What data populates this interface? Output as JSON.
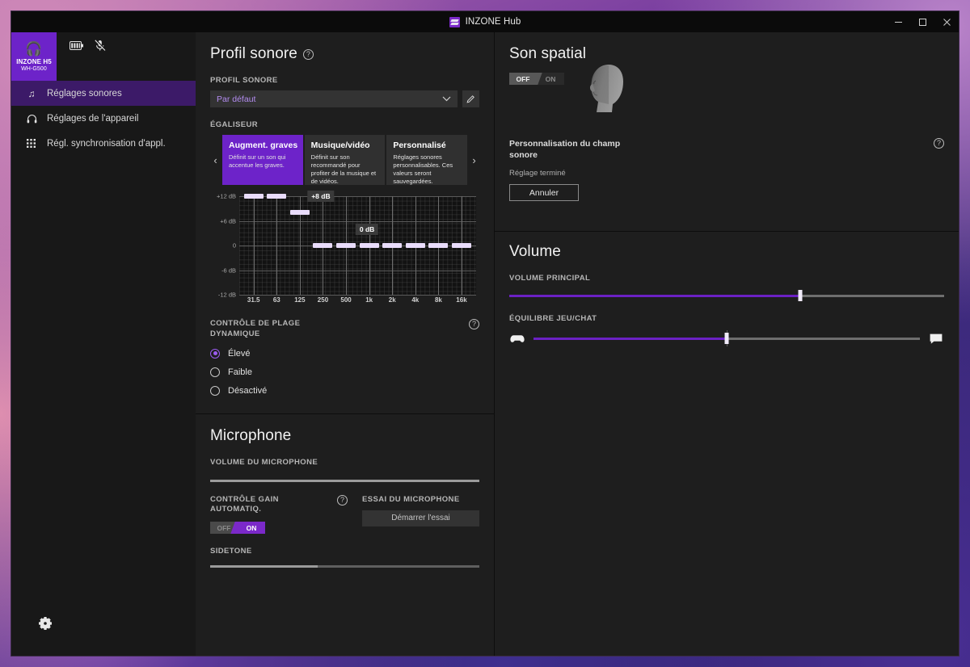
{
  "window": {
    "title": "INZONE Hub",
    "logo_icon": "inzone-logo",
    "controls": {
      "minimize": "–",
      "maximize": "□",
      "close": "✕"
    }
  },
  "sidebar": {
    "device": {
      "icon": "headset-icon",
      "name": "INZONE H5",
      "model": "WH-G500"
    },
    "status_icons": [
      {
        "name": "battery-icon"
      },
      {
        "name": "microphone-muted-icon"
      }
    ],
    "items": [
      {
        "icon": "music-note-icon",
        "label": "Réglages sonores",
        "active": true
      },
      {
        "icon": "headphones-icon",
        "label": "Réglages de l'appareil",
        "active": false
      },
      {
        "icon": "app-grid-icon",
        "label": "Régl. synchronisation d'appl.",
        "active": false
      }
    ],
    "settings_icon": "gear-icon"
  },
  "sound_profile": {
    "heading": "Profil sonore",
    "help_icon": "?",
    "profile_label": "PROFIL SONORE",
    "profile_value": "Par défaut",
    "chevron": "⌄",
    "edit_icon": "pencil-icon",
    "equalizer_label": "ÉGALISEUR",
    "prev_arrow": "‹",
    "next_arrow": "›",
    "presets": [
      {
        "title": "Augment. graves",
        "desc": "Définit sur un son qui accentue les graves.",
        "selected": true
      },
      {
        "title": "Musique/vidéo",
        "desc": "Définit sur son recommandé pour profiter de la musique et de vidéos.",
        "selected": false
      },
      {
        "title": "Personnalisé",
        "desc": "Réglages sonores personnalisables. Ces valeurs seront sauvegardées.",
        "selected": false
      }
    ],
    "dynamic_range": {
      "label": "CONTRÔLE DE PLAGE DYNAMIQUE",
      "help_icon": "?",
      "options": [
        {
          "label": "Élevé",
          "selected": true
        },
        {
          "label": "Faible",
          "selected": false
        },
        {
          "label": "Désactivé",
          "selected": false
        }
      ]
    }
  },
  "chart_data": {
    "type": "bar",
    "title": "ÉGALISEUR",
    "xlabel": "",
    "ylabel": "dB",
    "categories": [
      "31.5",
      "63",
      "125",
      "250",
      "500",
      "1k",
      "2k",
      "4k",
      "8k",
      "16k"
    ],
    "values": [
      12,
      12,
      8,
      0,
      0,
      0,
      0,
      0,
      0,
      0
    ],
    "ylim": [
      -12,
      12
    ],
    "ytick_labels": [
      "+12 dB",
      "+6 dB",
      "0",
      "-6 dB",
      "-12 dB"
    ],
    "ytick_values": [
      12,
      6,
      0,
      -6,
      -12
    ],
    "grid": true,
    "annotations": [
      {
        "text": "+8 dB",
        "x": "125",
        "y": 12
      },
      {
        "text": "0 dB",
        "x": "500",
        "y": 4
      }
    ],
    "legend": "none"
  },
  "microphone": {
    "heading": "Microphone",
    "volume_label": "VOLUME DU MICROPHONE",
    "volume_percent": 100,
    "agc": {
      "label": "CONTRÔLE GAIN AUTOMATIQ.",
      "help_icon": "?",
      "off_label": "OFF",
      "on_label": "ON",
      "state": "ON"
    },
    "test": {
      "label": "ESSAI DU MICROPHONE",
      "button": "Démarrer l'essai"
    },
    "sidetone_label": "SIDETONE",
    "sidetone_percent": 40
  },
  "spatial_sound": {
    "heading": "Son spatial",
    "toggle": {
      "off_label": "OFF",
      "on_label": "ON",
      "state": "OFF"
    },
    "head_icon": "head-3d-model",
    "custom_label": "Personnalisation du champ sonore",
    "help_icon": "?",
    "status": "Réglage terminé",
    "cancel_button": "Annuler"
  },
  "volume": {
    "heading": "Volume",
    "master_label": "VOLUME PRINCIPAL",
    "master_percent": 67,
    "balance_label": "ÉQUILIBRE JEU/CHAT",
    "balance_percent": 50,
    "game_icon": "gamepad-icon",
    "chat_icon": "chat-bubble-icon"
  }
}
